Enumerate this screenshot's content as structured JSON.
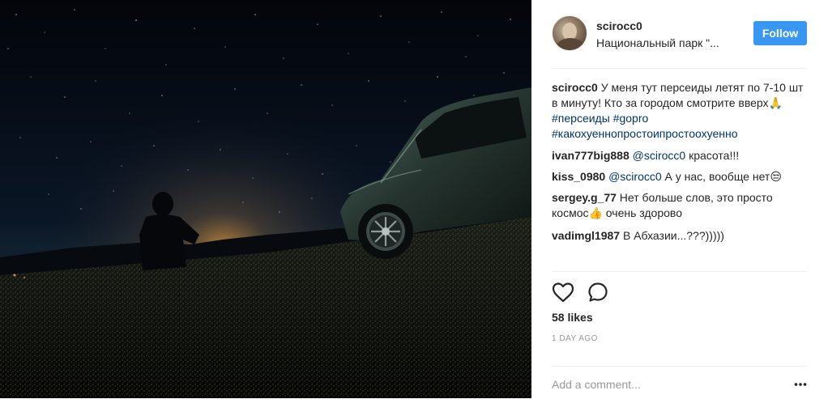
{
  "post": {
    "image_alt": "",
    "username": "scirocc0",
    "location": "Национальный парк \"...",
    "follow_label": "Follow"
  },
  "caption": {
    "user": "scirocc0",
    "text": "У меня тут персеиды летят по 7-10 шт в минуту! Кто за городом смотрите вверх⁠⁠🙏 ",
    "tags": [
      "#персеиды",
      "#gopro",
      "#какохуеннопростоипростоохуенно"
    ]
  },
  "comments": [
    {
      "user": "ivan777big888",
      "mention": "@scirocc0",
      "text": "красота!!!"
    },
    {
      "user": "kiss_0980",
      "mention": "@scirocc0",
      "text": "А у нас, вообще нет😒"
    },
    {
      "user": "sergey.g_77",
      "mention": "",
      "text": "Нет больше слов, это просто космос👍 очень здорово"
    },
    {
      "user": "vadimgl1987",
      "mention": "",
      "text": "В Абхазии...???)))))"
    }
  ],
  "actions": {
    "like_icon": "heart-outline-icon",
    "comment_icon": "speech-bubble-icon",
    "likes": "58 likes",
    "timestamp": "1 DAY AGO"
  },
  "add_comment": {
    "placeholder": "Add a comment...",
    "more_icon": "ellipsis-icon"
  },
  "colors": {
    "follow_button": "#3897f0",
    "link": "#003569",
    "muted": "#999999"
  }
}
